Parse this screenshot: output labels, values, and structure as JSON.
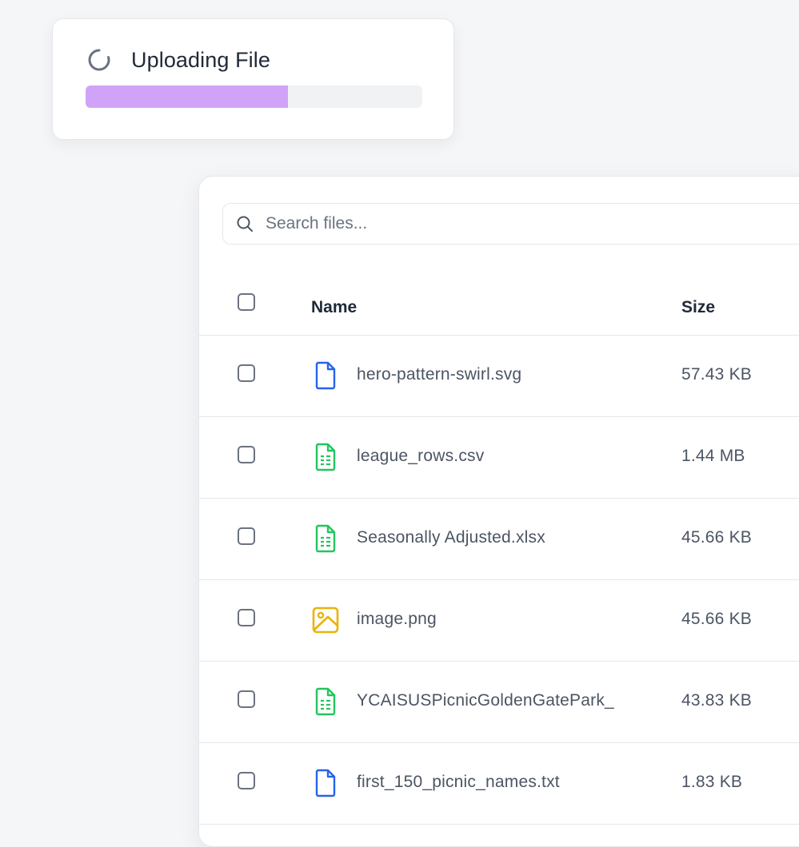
{
  "upload": {
    "title": "Uploading File",
    "progress": 0.6,
    "progress_color": "#d0a3f8",
    "icon": "spinner-icon"
  },
  "search": {
    "placeholder": "Search files...",
    "icon": "search-icon"
  },
  "table": {
    "headers": {
      "name": "Name",
      "size": "Size"
    },
    "rows": [
      {
        "name": "hero-pattern-swirl.svg",
        "size": "57.43 KB",
        "icon": "document-icon",
        "icon_color": "#2563eb"
      },
      {
        "name": "league_rows.csv",
        "size": "1.44 MB",
        "icon": "spreadsheet-icon",
        "icon_color": "#22c55e"
      },
      {
        "name": "Seasonally Adjusted.xlsx",
        "size": "45.66 KB",
        "icon": "spreadsheet-icon",
        "icon_color": "#22c55e"
      },
      {
        "name": "image.png",
        "size": "45.66 KB",
        "icon": "image-icon",
        "icon_color": "#eab308"
      },
      {
        "name": "YCAISUSPicnicGoldenGatePark_",
        "size": "43.83 KB",
        "icon": "spreadsheet-icon",
        "icon_color": "#22c55e"
      },
      {
        "name": "first_150_picnic_names.txt",
        "size": "1.83 KB",
        "icon": "document-icon",
        "icon_color": "#2563eb"
      }
    ]
  }
}
